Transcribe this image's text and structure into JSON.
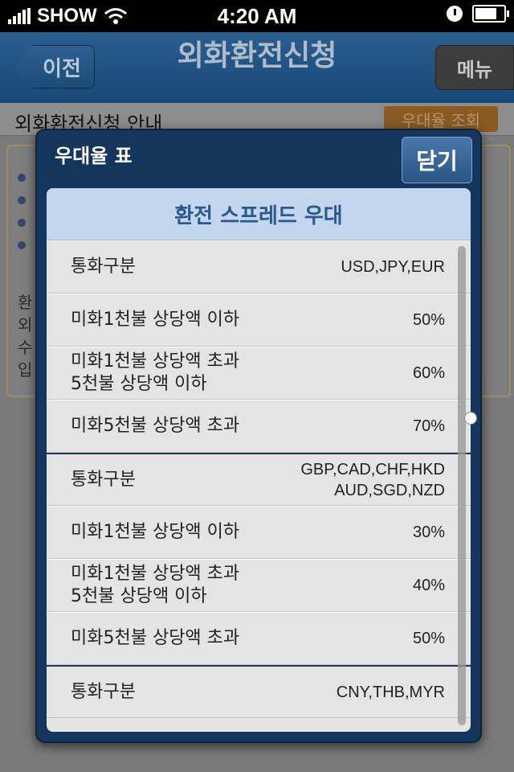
{
  "status_bar": {
    "carrier": "SHOW",
    "time": "4:20 AM"
  },
  "nav": {
    "back_label": "이전",
    "title": "외화환전신청",
    "menu_label": "메뉴"
  },
  "background": {
    "section_title": "외화환전신청 안내",
    "rate_button": "우대율 조회",
    "partial_lines": [
      "환",
      "외",
      "수",
      "입"
    ]
  },
  "popup": {
    "title": "우대율 표",
    "close_label": "닫기",
    "table_header": "환전 스프레드 우대",
    "rows": [
      {
        "label": "통화구분",
        "value": "USD,JPY,EUR"
      },
      {
        "label": "미화1천불 상당액 이하",
        "value": "50%"
      },
      {
        "label": "미화1천불 상당액 초과\n5천불 상당액 이하",
        "value": "60%"
      },
      {
        "label": "미화5천불 상당액 초과",
        "value": "70%"
      },
      {
        "label": "통화구분",
        "value": "GBP,CAD,CHF,HKD\nAUD,SGD,NZD"
      },
      {
        "label": "미화1천불 상당액 이하",
        "value": "30%"
      },
      {
        "label": "미화1천불 상당액 초과\n5천불 상당액 이하",
        "value": "40%"
      },
      {
        "label": "미화5천불 상당액 초과",
        "value": "50%"
      },
      {
        "label": "통화구분",
        "value": "CNY,THB,MYR"
      }
    ]
  }
}
